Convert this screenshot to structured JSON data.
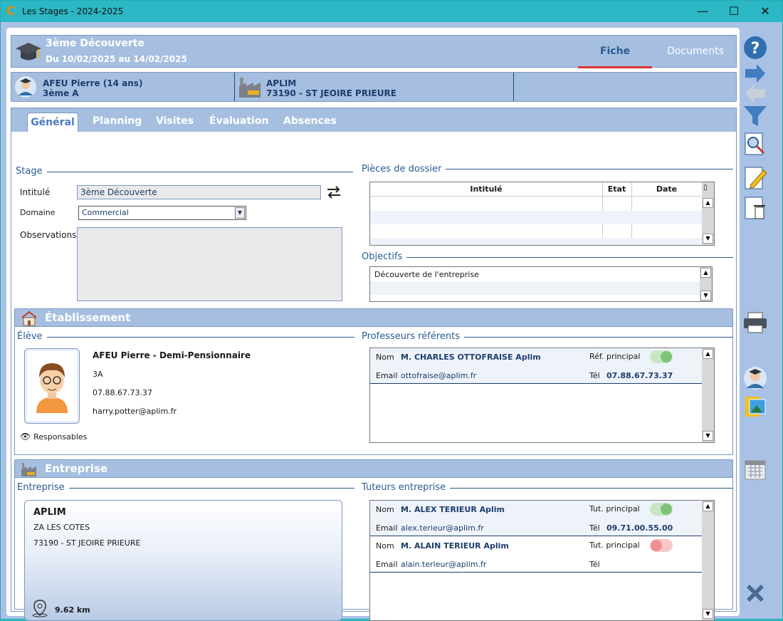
{
  "window": {
    "title": "Les Stages - 2024-2025",
    "min": "—",
    "max": "☐",
    "close": "✕"
  },
  "header": {
    "title": "3ème Découverte",
    "dates": "Du 10/02/2025 au 14/02/2025",
    "tab_fiche": "Fiche",
    "tab_documents": "Documents"
  },
  "info": {
    "student_name": "AFEU Pierre (14 ans)",
    "student_class": "3ème A",
    "company_name": "APLIM",
    "company_city": "73190 - ST JEOIRE PRIEURE"
  },
  "tabs": [
    "Général",
    "Planning",
    "Visites",
    "Évaluation",
    "Absences"
  ],
  "stage": {
    "group": "Stage",
    "intitule_label": "Intitulé",
    "intitule_value": "3ème Découverte",
    "domaine_label": "Domaine",
    "domaine_value": "Commercial",
    "observations_label": "Observations"
  },
  "pieces": {
    "group": "Pièces de dossier",
    "col_intitule": "Intitulé",
    "col_etat": "Etat",
    "col_date": "Date"
  },
  "objectifs": {
    "group": "Objectifs",
    "items": [
      "Découverte de l'entreprise"
    ]
  },
  "etablissement": {
    "title": "Établissement",
    "eleve_group": "Élève",
    "eleve_name": "AFEU Pierre - Demi-Pensionnaire",
    "eleve_class": "3A",
    "eleve_phone": "07.88.67.73.37",
    "eleve_email": "harry.potter@aplim.fr",
    "responsables": "Responsables"
  },
  "profs": {
    "group": "Professeurs référents",
    "nom_label": "Nom",
    "nom_value": "M. CHARLES OTTOFRAISE Aplim",
    "email_label": "Email",
    "email_value": "ottofraise@aplim.fr",
    "ref_label": "Réf. principal",
    "tel_label": "Tél",
    "tel_value": "07.88.67.73.37"
  },
  "entreprise": {
    "title": "Entreprise",
    "group": "Entreprise",
    "name": "APLIM",
    "address": "ZA LES COTES",
    "city": "73190 - ST JEOIRE PRIEURE",
    "distance": "9.62 km"
  },
  "tuteurs": {
    "group": "Tuteurs entreprise",
    "nom_label": "Nom",
    "email_label": "Email",
    "tut_label": "Tut. principal",
    "tel_label": "Tél",
    "rows": [
      {
        "nom": "M. ALEX TERIEUR Aplim",
        "email": "alex.terieur@aplim.fr",
        "tel": "09.71.00.55.00",
        "principal": true
      },
      {
        "nom": "M. ALAIN TERIEUR Aplim",
        "email": "alain.terieur@aplim.fr",
        "tel": "",
        "principal": false
      }
    ]
  },
  "colors": {
    "accent": "#2a5b93",
    "toggle_on": "#7dc47a",
    "toggle_off": "#f08f8f",
    "header_bg": "#a6bfe0"
  }
}
